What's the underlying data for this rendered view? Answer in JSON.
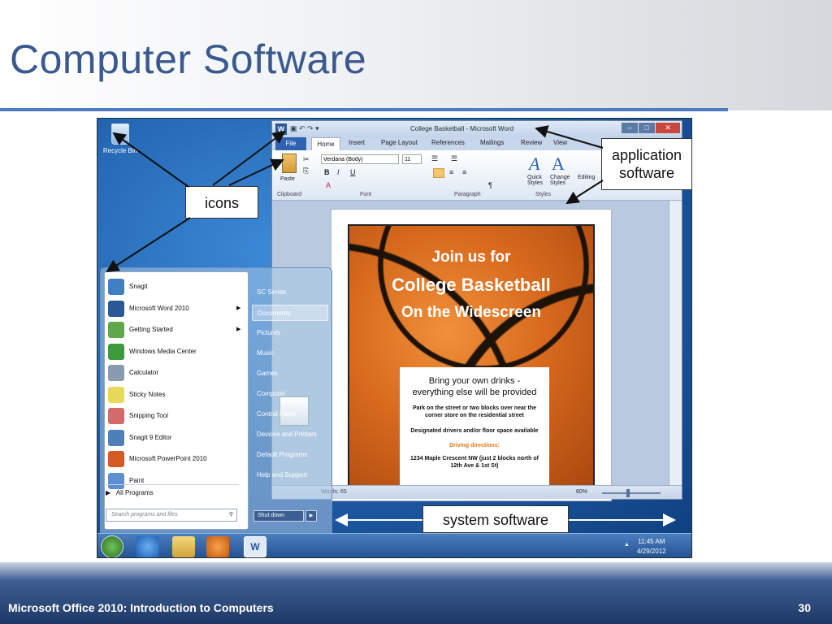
{
  "slide": {
    "title": "Computer Software",
    "footer": "Microsoft Office 2010: Introduction to Computers",
    "page_number": "30"
  },
  "callouts": {
    "icons": "icons",
    "application_line1": "application",
    "application_line2": "software",
    "system": "system software"
  },
  "desktop": {
    "recycle_bin_label": "Recycle Bin"
  },
  "word": {
    "window_title": "College Basketball - Microsoft Word",
    "tabs": [
      "File",
      "Home",
      "Insert",
      "Page Layout",
      "References",
      "Mailings",
      "Review",
      "View"
    ],
    "font_name": "Verdana (Body)",
    "font_size": "11",
    "groups": [
      "Clipboard",
      "Font",
      "Paragraph",
      "Styles"
    ],
    "paste_label": "Paste",
    "quick_styles_line1": "Quick",
    "quick_styles_line2": "Styles",
    "change_styles_line1": "Change",
    "change_styles_line2": "Styles",
    "editing_label": "Editing",
    "status_words": "Words: 65",
    "zoom": "60%"
  },
  "flyer": {
    "line1": "Join us for",
    "line2": "College Basketball",
    "line3": "On the Widescreen",
    "box_line1": "Bring your own drinks - everything else will be provided",
    "box_line2": "Park on the street or two blocks over near the corner store on the residential street",
    "box_line3": "Designated drivers and/or floor space available",
    "box_line4": "Driving directions:",
    "box_line5": "1234 Maple Crescent NW (just 2 blocks north of 12th Ave & 1st St)"
  },
  "start_menu": {
    "left_items": [
      {
        "label": "Snagit",
        "icon": "snagit-icon",
        "color": "#3f7fc2",
        "arrow": ""
      },
      {
        "label": "Microsoft Word 2010",
        "icon": "word-icon",
        "color": "#2b5797",
        "arrow": "▶"
      },
      {
        "label": "Getting Started",
        "icon": "getting-started-icon",
        "color": "#5fa84a",
        "arrow": "▶"
      },
      {
        "label": "Windows Media Center",
        "icon": "media-center-icon",
        "color": "#3c9a3c",
        "arrow": ""
      },
      {
        "label": "Calculator",
        "icon": "calculator-icon",
        "color": "#8a9bb0",
        "arrow": ""
      },
      {
        "label": "Sticky Notes",
        "icon": "sticky-notes-icon",
        "color": "#e9d95a",
        "arrow": ""
      },
      {
        "label": "Snipping Tool",
        "icon": "snipping-tool-icon",
        "color": "#d46a6a",
        "arrow": ""
      },
      {
        "label": "Snagit 9 Editor",
        "icon": "snagit-editor-icon",
        "color": "#4e7fb8",
        "arrow": ""
      },
      {
        "label": "Microsoft PowerPoint 2010",
        "icon": "powerpoint-icon",
        "color": "#d35b24",
        "arrow": ""
      },
      {
        "label": "Paint",
        "icon": "paint-icon",
        "color": "#5b8fd0",
        "arrow": ""
      }
    ],
    "all_programs": "All Programs",
    "search_placeholder": "Search programs and files",
    "right_items": [
      "SC Series",
      "Documents",
      "Pictures",
      "Music",
      "Games",
      "Computer",
      "Control Panel",
      "Devices and Printers",
      "Default Programs",
      "Help and Support"
    ],
    "active_right_item": "Documents",
    "shutdown": "Shut down"
  },
  "taskbar": {
    "time": "11:45 AM",
    "date": "4/29/2012"
  },
  "colors": {
    "title": "#3a5a8f",
    "rule": "#4f7cc0",
    "footer_dark": "#1d3866",
    "desktop": "#1f5da8"
  }
}
